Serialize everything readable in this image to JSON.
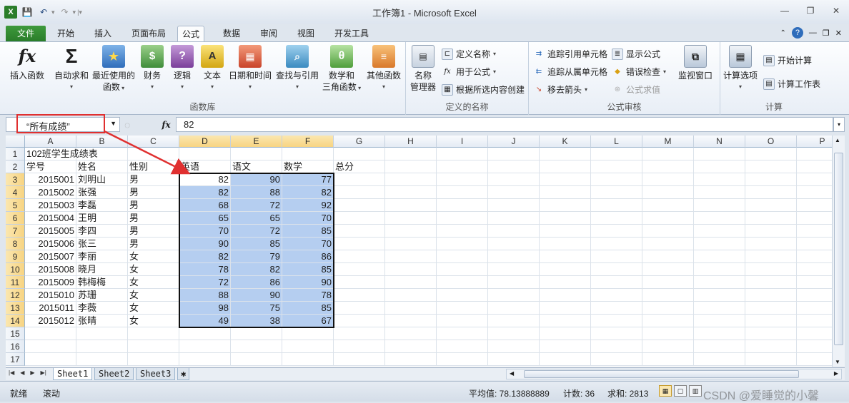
{
  "window": {
    "title": "工作簿1 - Microsoft Excel",
    "min": "—",
    "restore": "❐",
    "close": "✕"
  },
  "tabs": [
    {
      "label": "文件"
    },
    {
      "label": "开始"
    },
    {
      "label": "插入"
    },
    {
      "label": "页面布局"
    },
    {
      "label": "公式"
    },
    {
      "label": "数据"
    },
    {
      "label": "审阅"
    },
    {
      "label": "视图"
    },
    {
      "label": "开发工具"
    }
  ],
  "ribbon": {
    "library": {
      "label": "函数库",
      "insert_function": "插入函数",
      "autosum": "自动求和",
      "recent_line1": "最近使用的",
      "recent_line2": "函数",
      "financial": "财务",
      "logical": "逻辑",
      "text": "文本",
      "datetime": "日期和时间",
      "lookup": "查找与引用",
      "math_line1": "数学和",
      "math_line2": "三角函数",
      "more": "其他函数"
    },
    "names": {
      "label": "定义的名称",
      "manager_line1": "名称",
      "manager_line2": "管理器",
      "define_name": "定义名称",
      "use_in_formula": "用于公式",
      "create_from_selection": "根据所选内容创建"
    },
    "audit": {
      "label": "公式审核",
      "trace_precedents": "追踪引用单元格",
      "trace_dependents": "追踪从属单元格",
      "remove_arrows": "移去箭头",
      "show_formulas": "显示公式",
      "error_checking": "错误检查",
      "evaluate": "公式求值",
      "watch_line1": "监视窗口"
    },
    "calc": {
      "label": "计算",
      "options": "计算选项",
      "calc_now": "开始计算",
      "calc_sheet": "计算工作表"
    }
  },
  "formula_bar": {
    "name_box": "“所有成绩”",
    "fx": "fx",
    "value": "82"
  },
  "columns": [
    "A",
    "B",
    "C",
    "D",
    "E",
    "F",
    "G",
    "H",
    "I",
    "J",
    "K",
    "L",
    "M",
    "N",
    "O",
    "P"
  ],
  "rows": [
    "1",
    "2",
    "3",
    "4",
    "5",
    "6",
    "7",
    "8",
    "9",
    "10",
    "11",
    "12",
    "13",
    "14",
    "15",
    "16",
    "17"
  ],
  "sheet": {
    "title": "102班学生成绩表",
    "headers": [
      "学号",
      "姓名",
      "性别",
      "英语",
      "语文",
      "数学",
      "总分"
    ],
    "records": [
      [
        "2015001",
        "刘明山",
        "男",
        "82",
        "90",
        "77"
      ],
      [
        "2015002",
        "张强",
        "男",
        "82",
        "88",
        "82"
      ],
      [
        "2015003",
        "李磊",
        "男",
        "68",
        "72",
        "92"
      ],
      [
        "2015004",
        "王明",
        "男",
        "65",
        "65",
        "70"
      ],
      [
        "2015005",
        "李四",
        "男",
        "70",
        "72",
        "85"
      ],
      [
        "2015006",
        "张三",
        "男",
        "90",
        "85",
        "70"
      ],
      [
        "2015007",
        "李丽",
        "女",
        "82",
        "79",
        "86"
      ],
      [
        "2015008",
        "晓月",
        "女",
        "78",
        "82",
        "85"
      ],
      [
        "2015009",
        "韩梅梅",
        "女",
        "72",
        "86",
        "90"
      ],
      [
        "2015010",
        "苏珊",
        "女",
        "88",
        "90",
        "78"
      ],
      [
        "2015011",
        "李薇",
        "女",
        "98",
        "75",
        "85"
      ],
      [
        "2015012",
        "张晴",
        "女",
        "49",
        "38",
        "67"
      ]
    ]
  },
  "sheet_tabs": [
    "Sheet1",
    "Sheet2",
    "Sheet3"
  ],
  "status": {
    "ready": "就绪",
    "scroll": "滚动",
    "average": "平均值: 78.13888889",
    "count": "计数: 36",
    "sum": "求和: 2813",
    "watermark": "CSDN @爱睡觉的小馨"
  },
  "colors": {
    "highlight": "#b5cef0",
    "arrow": "#e03030",
    "file_tab": "#2a7d2a"
  }
}
